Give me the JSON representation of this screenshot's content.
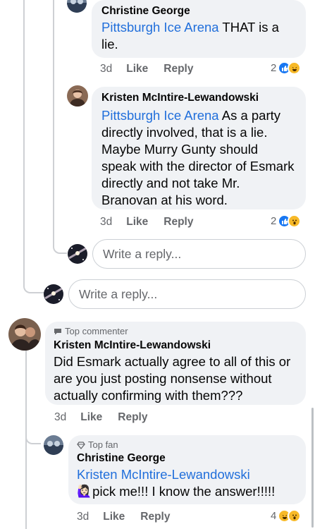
{
  "comments": [
    {
      "author": "Christine George",
      "mention": "Pittsburgh Ice Arena",
      "text": " THAT is a lie.",
      "time": "3d",
      "like_label": "Like",
      "reply_label": "Reply",
      "reaction_count": "2",
      "reactions": [
        "like-icon",
        "haha-icon"
      ]
    },
    {
      "author": "Kristen McIntire-Lewandowski",
      "mention": "Pittsburgh Ice Arena",
      "text": " As a party directly involved, that is a lie. Maybe Murry Gunty should speak with the director of Esmark directly and not take Mr. Branovan at his word.",
      "time": "3d",
      "like_label": "Like",
      "reply_label": "Reply",
      "reaction_count": "2",
      "reactions": [
        "like-icon",
        "wow-icon"
      ]
    },
    {
      "badge": "Top commenter",
      "author": "Kristen McIntire-Lewandowski",
      "text": "Did Esmark actually agree to all of this or are you just posting nonsense without actually confirming with them???",
      "time": "3d",
      "like_label": "Like",
      "reply_label": "Reply"
    },
    {
      "badge": "Top fan",
      "author": "Christine George",
      "mention": "Kristen McIntire-Lewandowski",
      "text": "pick me!!! I know the answer!!!!!",
      "emoji": "🙋🏻‍♀️",
      "time": "3d",
      "like_label": "Like",
      "reply_label": "Reply",
      "reaction_count": "4",
      "reactions": [
        "haha-icon",
        "wow-icon"
      ]
    }
  ],
  "reply_placeholder": "Write a reply...",
  "colors": {
    "bubble": "#f0f2f5",
    "mention": "#216fdb",
    "meta": "#65676b",
    "like": "#1877f2",
    "haha": "#f7b928"
  }
}
